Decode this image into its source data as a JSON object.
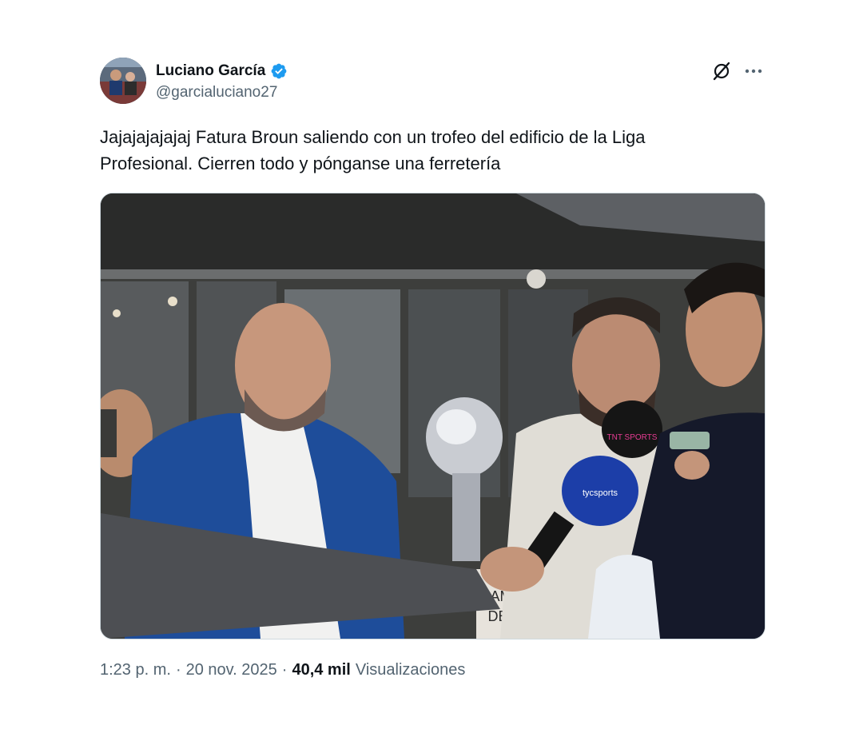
{
  "colors": {
    "text_primary": "#0f1419",
    "text_secondary": "#536471",
    "verified_blue": "#1d9bf0",
    "border": "#cfd9de"
  },
  "author": {
    "display_name": "Luciano García",
    "handle": "@garcialuciano27",
    "verified": true,
    "avatar_icon": "avatar-photo"
  },
  "actions": {
    "grok_icon": "grok-icon",
    "more_icon": "more-icon"
  },
  "tweet": {
    "text_line1": "Jajajajajajaj Fatura Broun saliendo con un trofeo del edificio de la Liga",
    "text_line2": "Profesional. Cierren todo y pónganse una ferretería"
  },
  "media": {
    "mic_blue_label": "tycsports",
    "mic_black_label": "TNT SPORTS",
    "trophy_label_line1": "CAMPEÓN",
    "trophy_label_line2": "DE LIGA"
  },
  "meta": {
    "time": "1:23 p. m.",
    "separator": "·",
    "date": "20 nov. 2025",
    "views_count": "40,4 mil",
    "views_label": "Visualizaciones"
  }
}
